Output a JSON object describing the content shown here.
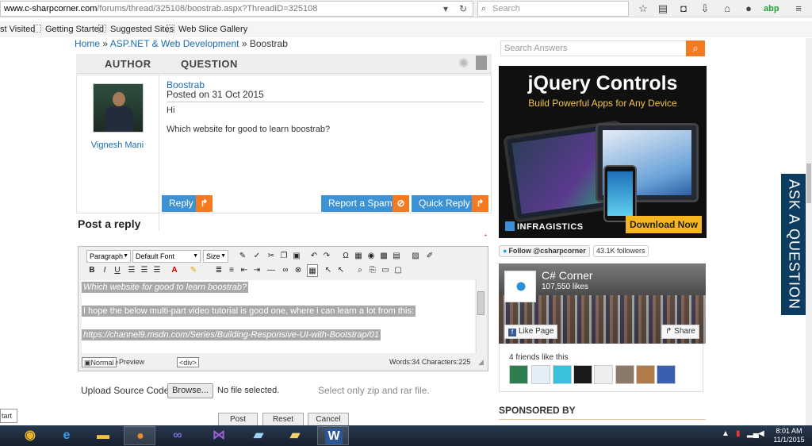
{
  "browser": {
    "url_host": "www.c-sharpcorner.com",
    "url_path": "/forums/thread/325108/boostrab.aspx?ThreadID=325108",
    "search_placeholder": "Search",
    "bookmarks": [
      "st Visited",
      "Getting Started",
      "Suggested Sites",
      "Web Slice Gallery"
    ]
  },
  "breadcrumb": {
    "home": "Home",
    "sep": "»",
    "section": "ASP.NET & Web Development",
    "current": "Boostrab"
  },
  "thread": {
    "col_author": "AUTHOR",
    "col_question": "QUESTION",
    "author": "Vignesh Mani",
    "title": "Boostrab",
    "posted": "Posted on 31 Oct 2015",
    "body_line1": "Hi",
    "body_line2": "Which website for good to learn boostrab?",
    "actions": {
      "reply": "Reply",
      "spam": "Report a Spam",
      "quick_reply": "Quick Reply"
    }
  },
  "reply": {
    "heading": "Post a reply",
    "required_mark": "*",
    "toolbar": {
      "paragraph": "Paragraph",
      "font": "Default Font",
      "size": "Size"
    },
    "content": {
      "line1": "Which website for good to learn boostrab?",
      "line2": "I hope the below multi-part video tutorial is good one, where i can learn a lot from this:",
      "line3": "https://channel9.msdn.com/Series/Building-Responsive-UI-with-Bootstrap/01"
    },
    "modes": {
      "normal": "Normal",
      "preview": "Preview",
      "tag": "<div>"
    },
    "counts": "Words:34 Characters:225",
    "upload_label": "Upload Source Code:",
    "browse": "Browse...",
    "no_file": "No file selected.",
    "zip_note": "Select only zip and rar file.",
    "buttons": {
      "post": "Post",
      "reset": "Reset",
      "cancel": "Cancel"
    }
  },
  "sidebar": {
    "search_placeholder": "Search Answers",
    "ad": {
      "title": "jQuery Controls",
      "subtitle": "Build Powerful Apps for Any Device",
      "brand": "INFRAGISTICS",
      "cta": "Download Now"
    },
    "twitter": {
      "follow": "Follow @csharpcorner",
      "followers": "43.1K followers"
    },
    "facebook": {
      "name": "C# Corner",
      "likes": "107,550 likes",
      "like": "Like Page",
      "share": "Share",
      "friends": "4 friends like this"
    },
    "sponsored": "SPONSORED BY",
    "ask": "ASK A QUESTION"
  },
  "os": {
    "start_tip": "tart",
    "time": "8:01 AM",
    "date": "11/1/2015"
  },
  "colors": {
    "link": "#1a6bb5",
    "button": "#3c92d2",
    "accent": "#f4791f",
    "ask_tab": "#0d3c61"
  }
}
